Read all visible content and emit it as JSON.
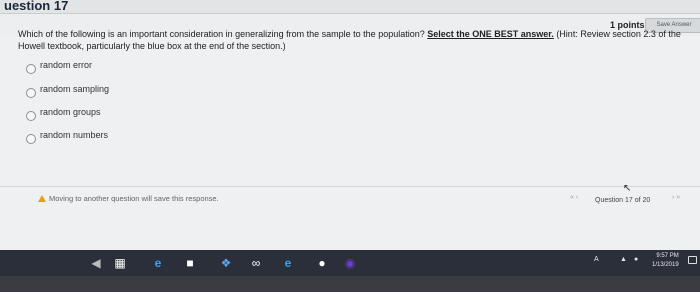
{
  "header": {
    "question_title": "uestion 17",
    "points_text": "1 points",
    "save_label": "Save Answer"
  },
  "question": {
    "text_before": "Which of the following is an important consideration in generalizing from the sample to the population?",
    "select_text": "Select the ONE BEST answer.",
    "text_after": "(Hint: Review section 2.3 of the Howell textbook, particularly the blue box at the end of the section.)"
  },
  "options": [
    {
      "label": "random error"
    },
    {
      "label": "random sampling"
    },
    {
      "label": "random groups"
    },
    {
      "label": "random numbers"
    }
  ],
  "footer": {
    "warning_text": "Moving to another question will save this response.",
    "question_counter": "Question 17 of 20",
    "prev_symbol": "«  ‹",
    "next_symbol": "›  »"
  },
  "taskbar": {
    "icons": [
      "back-icon",
      "task-view-icon",
      "edge-icon",
      "mail-icon",
      "dropbox-icon",
      "infinity-icon",
      "edge-alt-icon",
      "chrome-icon",
      "firefox-icon"
    ],
    "time": "9:57 PM",
    "date": "1/13/2019",
    "people_label": "A"
  },
  "colors": {
    "screen_bg": "#eef0f1",
    "taskbar_bg": "#1f2229",
    "warning": "#e0a11b",
    "edge_blue": "#3aa0f0",
    "firefox_purple": "#6b3fc8"
  }
}
